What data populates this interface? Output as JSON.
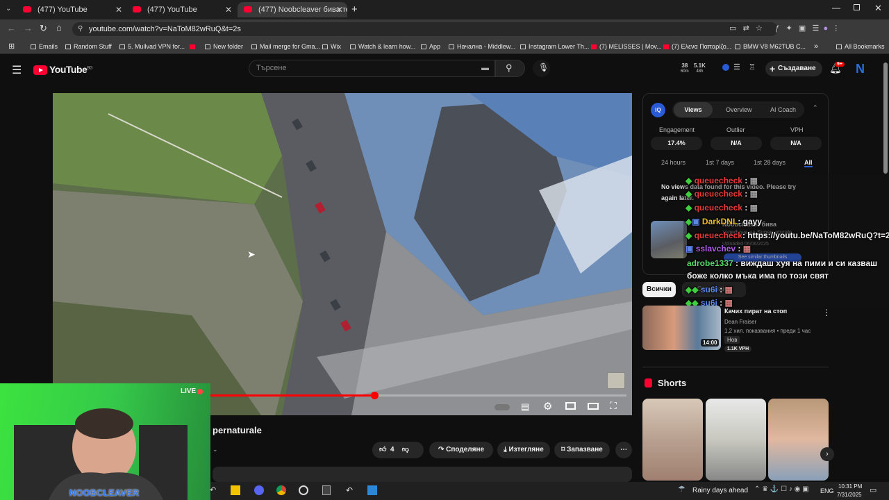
{
  "tabs": [
    {
      "label": "(477) YouTube"
    },
    {
      "label": "(477) YouTube"
    },
    {
      "label": "(477) Noobcleaver бива те"
    }
  ],
  "address": {
    "url": "youtube.com/watch?v=NaToM82wRuQ&t=2s"
  },
  "bookmarks": [
    "Emails",
    "Random Stuff",
    "5. Mullvad VPN for...",
    "New folder",
    "Mail merge for Gma...",
    "Wix",
    "Watch & learn how...",
    "App",
    "Начална - Middlew...",
    "Instagram Lower Th...",
    "(7) MELISSES | Mov...",
    "(7) Ελενα Παπαρίζο...",
    "BMW V8 M62TUB C...",
    "All Bookmarks"
  ],
  "header": {
    "logo": "YouTube",
    "country": "BG",
    "search_placeholder": "Търсене",
    "create": "Създаване",
    "notifications": "9+",
    "avatar": "N",
    "stat1": "38",
    "stat1_sub": "60m",
    "stat2": "5.1K",
    "stat2_sub": "48h"
  },
  "panel": {
    "logo": "IQ",
    "tabs": [
      "Views",
      "Overview",
      "AI Coach"
    ],
    "metrics": [
      {
        "label": "Engagement",
        "value": "17.4%"
      },
      {
        "label": "Outlier",
        "value": "N/A"
      },
      {
        "label": "VPH",
        "value": "N/A"
      }
    ],
    "ranges": [
      "24 hours",
      "1st 7 days",
      "1st 28 days",
      "All"
    ],
    "message": "No views data found for this video. Please try again later.",
    "thumb_title": "Noobcleaver бива",
    "thumb_sub": "телефона на Supernaturale",
    "thumb_meta": "Uploaded 06/06/2025",
    "similar": "See similar thumbnails"
  },
  "chat": [
    {
      "user": "queuecheck",
      "color": "#e63a3a",
      "msg": ":"
    },
    {
      "user": "queuecheck",
      "color": "#e63a3a",
      "msg": ":"
    },
    {
      "user": "queuecheck",
      "color": "#e63a3a",
      "msg": ":"
    },
    {
      "user": "DarkDNL",
      "color": "#e8c12c",
      "msg": ": gayy"
    },
    {
      "user": "queuecheck",
      "color": "#e63a3a",
      "msg": ": https://youtu.be/NaToM82wRuQ?t=2"
    },
    {
      "user": "sslavchev",
      "color": "#b05ee8",
      "msg": ":"
    },
    {
      "user": "adrobe1337",
      "color": "#59d96a",
      "msg": ": виждаш хуя на пими и си казваш"
    },
    {
      "user": "",
      "color": "#fff",
      "msg": "боже колко мъка има по този свят"
    },
    {
      "user": "su6i",
      "color": "#5b86e8",
      "msg": ":"
    },
    {
      "user": "su6i",
      "color": "#5b86e8",
      "msg": ":"
    }
  ],
  "filters": {
    "all": "Всички",
    "other": "Свързани"
  },
  "rec": {
    "title": "Качих пират на стоп",
    "channel": "Dean Fraiser",
    "meta": "1,2 хил. показвания • преди 1 час",
    "badge": "Нов",
    "vph": "1.1K VPH",
    "duration": "14:00"
  },
  "shorts": {
    "label": "Shorts"
  },
  "video": {
    "title_partial": "pernaturale",
    "progress": 0.56
  },
  "actions": {
    "likes": "4",
    "share": "Споделяне",
    "download": "Изтегляне",
    "save": "Запазване"
  },
  "cam": {
    "live": "LIVE",
    "name": "NOOBCLEAVER"
  },
  "taskbar": {
    "weather": "Rainy days ahead",
    "lang": "ENG",
    "time": "10:31 PM",
    "date": "7/31/2025"
  }
}
